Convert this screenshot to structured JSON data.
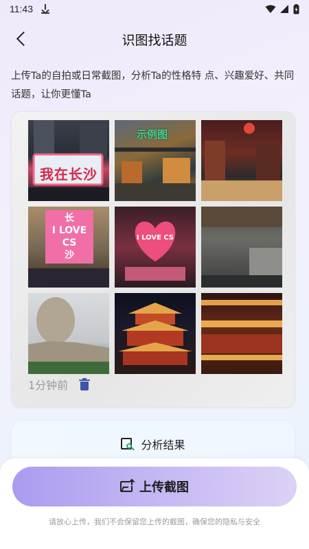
{
  "status_bar": {
    "time": "11:43"
  },
  "nav": {
    "title": "识图找话题"
  },
  "description": "上传Ta的自拍或日常截图，分析Ta的性格特 点、兴趣爱好、共同话题，让你更懂Ta",
  "example": {
    "badge": "示例图",
    "timestamp": "1分钟前",
    "photos": [
      {
        "name": "photo-night-billboard",
        "text": "我在长沙"
      },
      {
        "name": "photo-street-aerial",
        "text": ""
      },
      {
        "name": "photo-market-crowd",
        "text": ""
      },
      {
        "name": "photo-pink-screen",
        "text": "长\nI LOVE CS\n沙"
      },
      {
        "name": "photo-heart-sign",
        "text": "I LOVE CS"
      },
      {
        "name": "photo-crowd-street",
        "text": ""
      },
      {
        "name": "photo-statue",
        "text": ""
      },
      {
        "name": "photo-pavilion-night",
        "text": ""
      },
      {
        "name": "photo-pavilion-closeup",
        "text": ""
      }
    ]
  },
  "analyze": {
    "label": "分析结果"
  },
  "upload": {
    "label": "上传截图"
  },
  "privacy_note": "请放心上传，我们不会保留您上传的截图，确保您的隐私与安全",
  "colors": {
    "accent_green": "#3fd28c",
    "icon_blue": "#3c57a8",
    "button_from": "#ab9bf0",
    "button_to": "#dcd1f5"
  }
}
